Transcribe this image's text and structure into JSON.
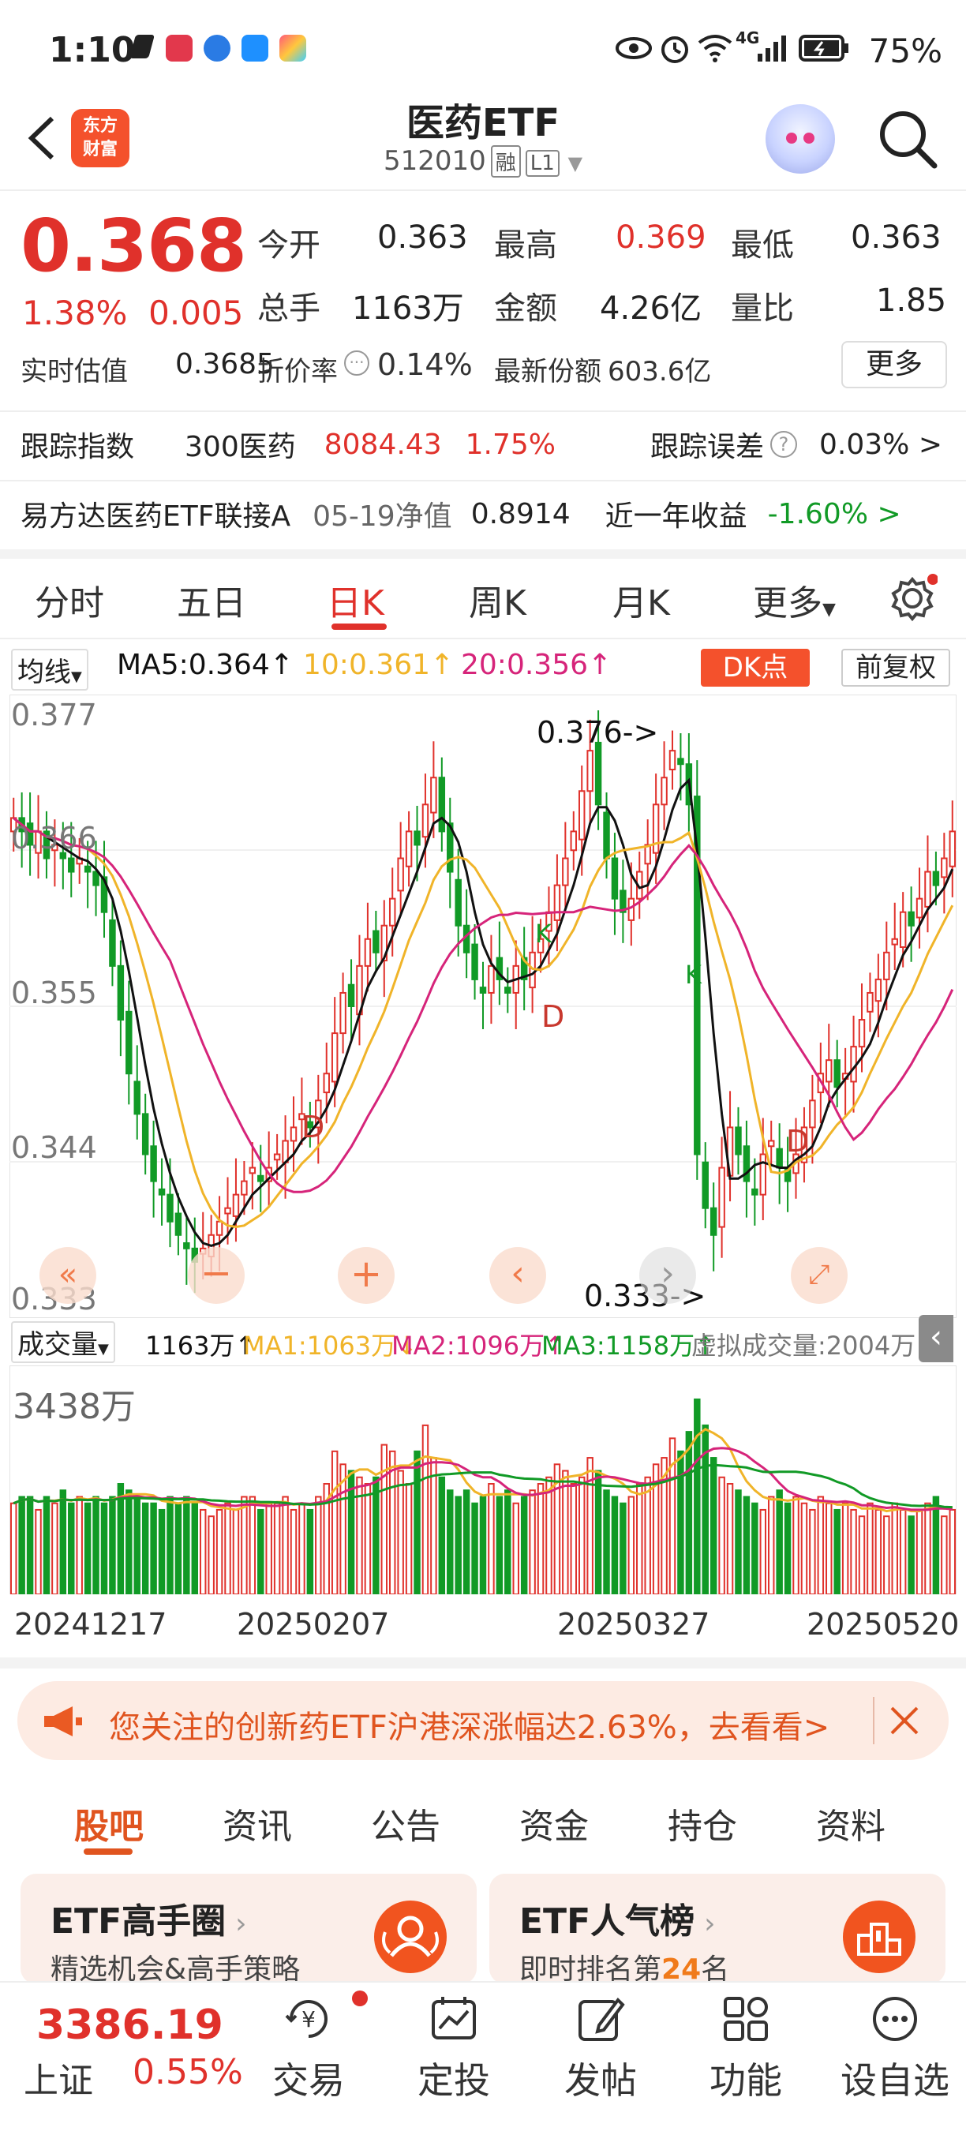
{
  "status_bar": {
    "time": "1:10",
    "network": "4G",
    "battery": "75%"
  },
  "header": {
    "logo_text": [
      "东方",
      "财富"
    ],
    "title": "医药ETF",
    "code": "512010",
    "tag_margin": "融",
    "tag_level": "L1"
  },
  "quote": {
    "price": "0.368",
    "change_pct": "1.38%",
    "change_amt": "0.005",
    "open_label": "今开",
    "open": "0.363",
    "high_label": "最高",
    "high": "0.369",
    "low_label": "最低",
    "low": "0.363",
    "vol_label": "总手",
    "vol": "1163万",
    "amount_label": "金额",
    "amount": "4.26亿",
    "ratio_label": "量比",
    "ratio": "1.85",
    "est_label": "实时估值",
    "est": "0.3685",
    "discount_label": "折价率",
    "discount": "0.14%",
    "share_label": "最新份额",
    "share": "603.6亿",
    "more_label": "更多"
  },
  "tracking": {
    "label": "跟踪指数",
    "index_name": "300医药",
    "index_value": "8084.43",
    "index_pct": "1.75%",
    "error_label": "跟踪误差",
    "error": "0.03% >"
  },
  "linked": {
    "name": "易方达医药ETF联接A",
    "nav_label": "05-19净值",
    "nav": "0.8914",
    "ret_label": "近一年收益",
    "ret": "-1.60% >"
  },
  "chart_tabs": [
    "分时",
    "五日",
    "日K",
    "周K",
    "月K",
    "更多"
  ],
  "ma": {
    "selector": "均线",
    "ma5": "MA5:0.364↑",
    "ma10": "10:0.361↑",
    "ma20": "20:0.356↑",
    "dk": "DK点",
    "adjust": "前复权"
  },
  "volume_header": {
    "selector": "成交量",
    "vol": "1163万↑",
    "ma1": "MA1:1063万↓",
    "ma2": "MA2:1096万↑",
    "ma3": "MA3:1158万↑",
    "virtual": "虚拟成交量:2004万"
  },
  "colors": {
    "up": "#e0312b",
    "down": "#119a26",
    "ma5": "#111111",
    "ma10": "#f0b429",
    "ma20": "#d6247a",
    "brand": "#f4512c"
  },
  "chart_data": {
    "type": "candlestick",
    "y_ticks": [
      "0.377",
      "0.366",
      "0.355",
      "0.344",
      "0.333"
    ],
    "ylim": [
      0.333,
      0.377
    ],
    "x_ticks": [
      "20241217",
      "20250207",
      "20250327",
      "20250520"
    ],
    "annotations": {
      "high": "0.376->",
      "low": "0.333->"
    },
    "markers": [
      "D",
      "K",
      "D",
      "K",
      "D"
    ],
    "volume_axis_max": "3438万",
    "closes": [
      0.369,
      0.368,
      0.367,
      0.368,
      0.366,
      0.367,
      0.366,
      0.365,
      0.366,
      0.365,
      0.364,
      0.362,
      0.358,
      0.354,
      0.35,
      0.347,
      0.344,
      0.342,
      0.341,
      0.339,
      0.338,
      0.337,
      0.336,
      0.337,
      0.338,
      0.339,
      0.34,
      0.341,
      0.342,
      0.343,
      0.342,
      0.343,
      0.344,
      0.345,
      0.346,
      0.347,
      0.346,
      0.348,
      0.35,
      0.353,
      0.356,
      0.355,
      0.358,
      0.36,
      0.359,
      0.361,
      0.363,
      0.366,
      0.368,
      0.367,
      0.37,
      0.372,
      0.368,
      0.365,
      0.361,
      0.359,
      0.357,
      0.356,
      0.358,
      0.357,
      0.356,
      0.358,
      0.357,
      0.359,
      0.36,
      0.362,
      0.364,
      0.366,
      0.368,
      0.371,
      0.374,
      0.37,
      0.366,
      0.363,
      0.362,
      0.363,
      0.365,
      0.367,
      0.37,
      0.372,
      0.374,
      0.373,
      0.37,
      0.344,
      0.34,
      0.338,
      0.343,
      0.346,
      0.344,
      0.342,
      0.341,
      0.344,
      0.345,
      0.343,
      0.342,
      0.344,
      0.346,
      0.348,
      0.35,
      0.351,
      0.349,
      0.35,
      0.352,
      0.354,
      0.356,
      0.357,
      0.359,
      0.36,
      0.362,
      0.361,
      0.363,
      0.365,
      0.364,
      0.366,
      0.368
    ],
    "volumes": [
      14,
      15,
      15,
      13,
      15,
      14,
      16,
      14,
      15,
      14,
      15,
      14,
      15,
      17,
      16,
      15,
      14,
      14,
      13,
      15,
      14,
      15,
      14,
      13,
      12,
      13,
      14,
      13,
      15,
      15,
      13,
      14,
      14,
      15,
      13,
      14,
      13,
      15,
      17,
      22,
      20,
      19,
      18,
      17,
      18,
      23,
      22,
      19,
      17,
      22,
      26,
      21,
      18,
      16,
      15,
      16,
      14,
      15,
      17,
      15,
      16,
      14,
      15,
      16,
      17,
      18,
      20,
      19,
      17,
      18,
      21,
      19,
      16,
      15,
      14,
      15,
      17,
      18,
      20,
      21,
      24,
      22,
      25,
      30,
      26,
      21,
      18,
      17,
      16,
      15,
      14,
      13,
      15,
      16,
      14,
      15,
      14,
      13,
      15,
      14,
      13,
      14,
      13,
      12,
      14,
      13,
      12,
      14,
      13,
      12,
      13,
      14,
      15,
      12,
      13
    ]
  },
  "banner": {
    "text": "您关注的创新药ETF沪港深涨幅达2.63%，去看看>"
  },
  "lower_tabs": [
    "股吧",
    "资讯",
    "公告",
    "资金",
    "持仓",
    "资料"
  ],
  "cards": [
    {
      "title": "ETF高手圈",
      "sub": "精选机会&高手策略"
    },
    {
      "title": "ETF人气榜",
      "sub_pre": "即时排名第",
      "rank": "24",
      "sub_post": "名"
    }
  ],
  "bottom_index": {
    "value": "3386.19",
    "name": "上证",
    "pct": "0.55%"
  },
  "bottom_nav": [
    "交易",
    "定投",
    "发帖",
    "功能",
    "设自选"
  ]
}
